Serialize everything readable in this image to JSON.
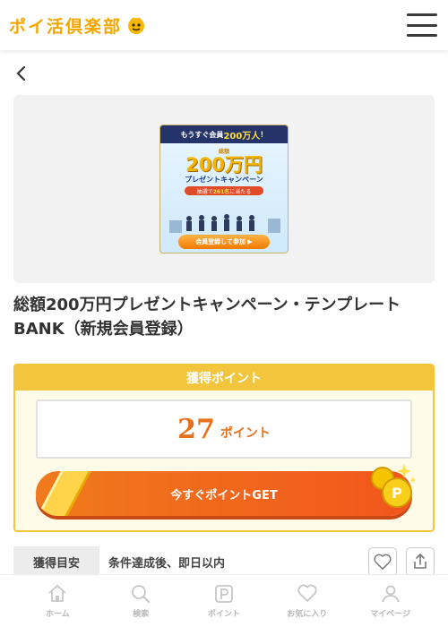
{
  "header": {
    "logo_text": "ポイ活倶楽部",
    "menu_icon": "hamburger-menu-icon"
  },
  "back_icon": "chevron-left-icon",
  "banner": {
    "top_text_prefix": "もうすぐ会員",
    "top_text_highlight": "200万人",
    "top_text_suffix": "！",
    "small_text": "総額",
    "big_text": "200万円",
    "sub_text": "プレゼントキャンペーン",
    "pill_prefix": "抽選で",
    "pill_highlight": "261名",
    "pill_suffix": "に当たる",
    "button_text": "会員登録して参加 ▶"
  },
  "title": "総額200万円プレゼントキャンペーン・テンプレートBANK（新規会員登録）",
  "points_card": {
    "header": "獲得ポイント",
    "points_value": "27",
    "points_unit": "ポイント",
    "get_button": "今すぐポイントGET"
  },
  "info": {
    "label": "獲得目安",
    "value": "条件達成後、即日以内"
  },
  "actions": {
    "favorite_icon": "heart-icon",
    "share_icon": "share-icon"
  },
  "bottom_nav": [
    {
      "label": "ホーム",
      "icon": "home-icon"
    },
    {
      "label": "検索",
      "icon": "search-icon"
    },
    {
      "label": "ポイント",
      "icon": "point-icon"
    },
    {
      "label": "お気に入り",
      "icon": "heart-icon"
    },
    {
      "label": "マイページ",
      "icon": "user-icon"
    }
  ],
  "colors": {
    "brand_yellow": "#f2c53d",
    "accent_orange": "#e8701a",
    "button_orange": "#f2561c"
  }
}
